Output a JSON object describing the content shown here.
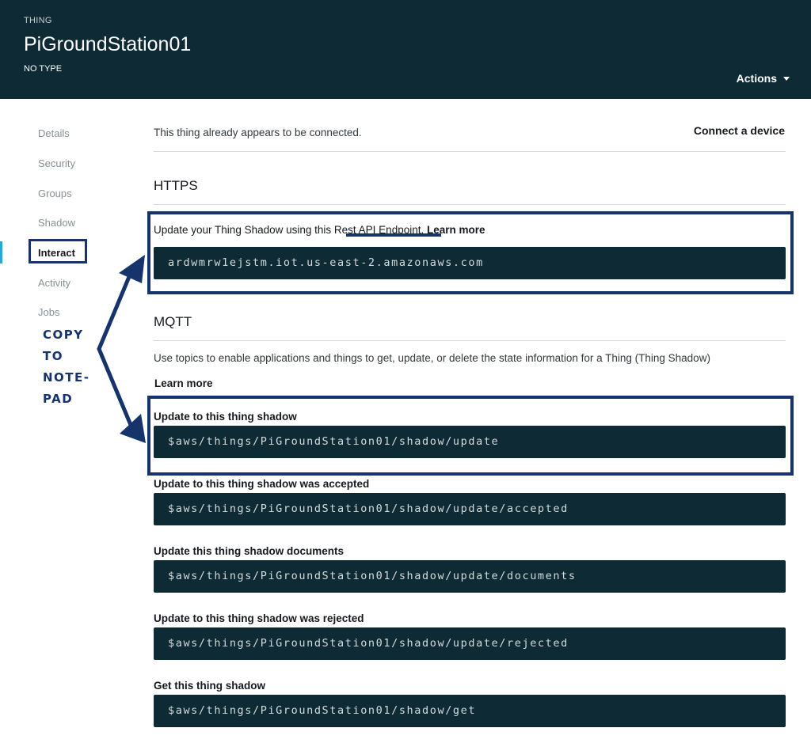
{
  "header": {
    "kicker": "THING",
    "title": "PiGroundStation01",
    "type": "NO TYPE",
    "actions_label": "Actions"
  },
  "sidebar": {
    "items": [
      {
        "label": "Details"
      },
      {
        "label": "Security"
      },
      {
        "label": "Groups"
      },
      {
        "label": "Shadow"
      },
      {
        "label": "Interact",
        "active": true
      },
      {
        "label": "Activity"
      },
      {
        "label": "Jobs"
      }
    ]
  },
  "annotation": {
    "lines": [
      "COPY",
      "TO",
      "NOTE-",
      "PAD"
    ],
    "color": "#16336b"
  },
  "main": {
    "status_text": "This thing already appears to be connected.",
    "connect_label": "Connect a device",
    "https": {
      "title": "HTTPS",
      "desc_prefix": "Update your Thing Shadow using this ",
      "endpoint_link": "Rest API Endpoint.",
      "learn_more": "Learn more",
      "endpoint": "ardwmrw1ejstm.iot.us-east-2.amazonaws.com"
    },
    "mqtt": {
      "title": "MQTT",
      "desc": "Use topics to enable applications and things to get, update, or delete the state information for a Thing (Thing Shadow)",
      "learn_more": "Learn more",
      "topics": [
        {
          "label": "Update to this thing shadow",
          "value": "$aws/things/PiGroundStation01/shadow/update"
        },
        {
          "label": "Update to this thing shadow was accepted",
          "value": "$aws/things/PiGroundStation01/shadow/update/accepted"
        },
        {
          "label": "Update this thing shadow documents",
          "value": "$aws/things/PiGroundStation01/shadow/update/documents"
        },
        {
          "label": "Update to this thing shadow was rejected",
          "value": "$aws/things/PiGroundStation01/shadow/update/rejected"
        },
        {
          "label": "Get this thing shadow",
          "value": "$aws/things/PiGroundStation01/shadow/get"
        }
      ]
    }
  },
  "colors": {
    "header_bg": "#0e2a35",
    "code_bg": "#0e2a35",
    "annotation": "#16336b",
    "active_nav": "#2ca5d8"
  }
}
